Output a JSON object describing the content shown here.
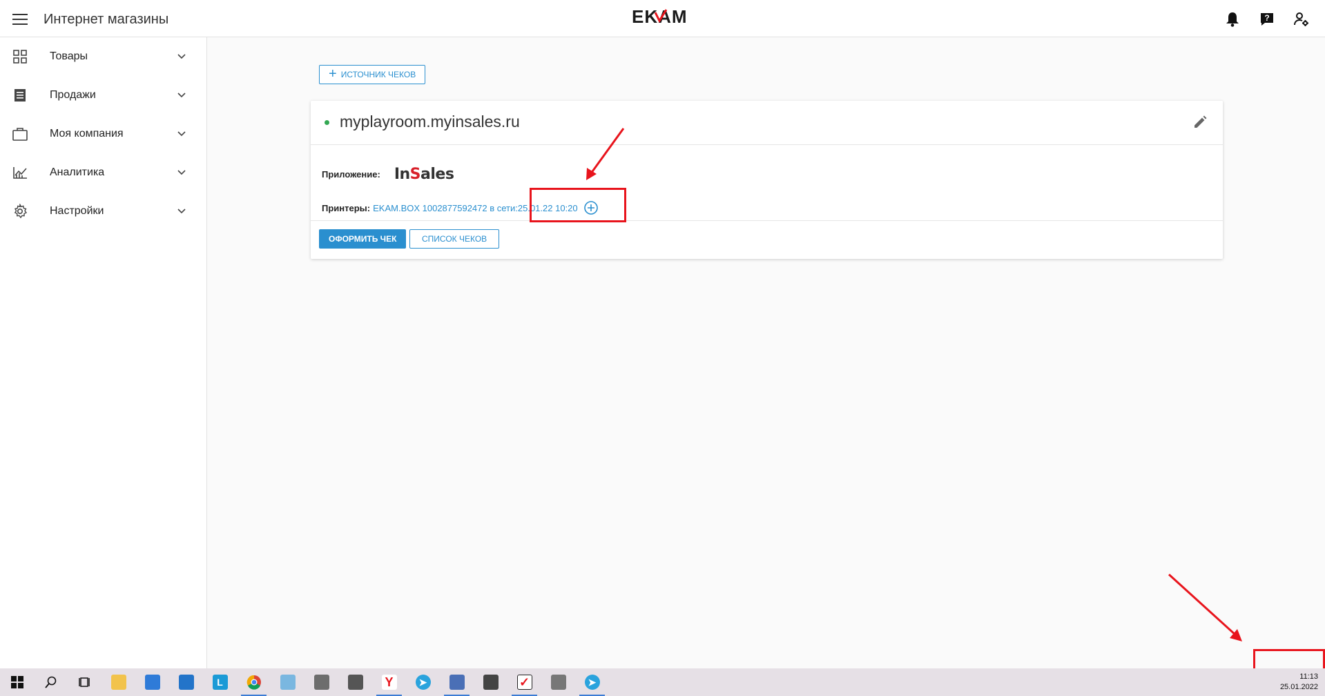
{
  "header": {
    "title": "Интернет магазины",
    "logo_text": "EKAM"
  },
  "sidebar": {
    "items": [
      {
        "label": "Товары",
        "icon": "grid-icon"
      },
      {
        "label": "Продажи",
        "icon": "list-icon"
      },
      {
        "label": "Моя компания",
        "icon": "briefcase-icon"
      },
      {
        "label": "Аналитика",
        "icon": "analytics-icon"
      },
      {
        "label": "Настройки",
        "icon": "gear-icon"
      }
    ]
  },
  "main": {
    "add_source_label": "ИСТОЧНИК ЧЕКОВ",
    "card": {
      "store_name": "myplayroom.myinsales.ru",
      "app_label": "Приложение:",
      "app_logo": {
        "part1": "In",
        "part2": "S",
        "part3": "ales"
      },
      "printers_label": "Принтеры:",
      "printer_value": "EKAM.BOX 1002877592472 в сети:",
      "printer_time": "25.01.22 10:20",
      "btn_checkout": "ОФОРМИТЬ ЧЕК",
      "btn_list": "СПИСОК ЧЕКОВ"
    }
  },
  "taskbar": {
    "time": "11:13",
    "date": "25.01.2022",
    "apps": [
      "windows-start",
      "search",
      "task-view",
      "file-explorer",
      "store",
      "mail",
      "l-app",
      "chrome",
      "magnifier",
      "printer-app",
      "usb-app",
      "yandex",
      "telegram",
      "network-app",
      "scanner",
      "kkm-app",
      "cash-register",
      "telegram-2"
    ]
  },
  "colors": {
    "accent": "#2a8fcf",
    "online": "#34a853",
    "annotation": "#e8141c"
  }
}
